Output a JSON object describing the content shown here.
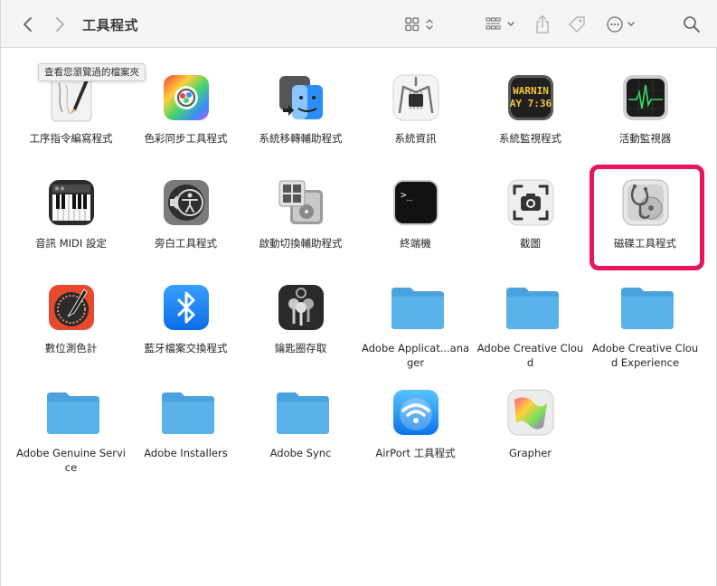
{
  "window": {
    "title": "工具程式",
    "tooltip": "查看您瀏覽過的檔案夾"
  },
  "toolbar": {
    "back_icon": "chevron-left-icon",
    "forward_icon": "chevron-right-icon",
    "view_icon": "grid-view-icon",
    "group_icon": "group-by-icon",
    "share_icon": "share-icon",
    "tag_icon": "tag-icon",
    "action_icon": "ellipsis-circle-icon",
    "search_icon": "search-icon"
  },
  "items": [
    {
      "label": "工序指令編寫程式",
      "icon": "script-editor-icon"
    },
    {
      "label": "色彩同步工具程式",
      "icon": "colorsync-icon"
    },
    {
      "label": "系統移轉輔助程式",
      "icon": "migration-assistant-icon"
    },
    {
      "label": "系統資訊",
      "icon": "system-information-icon"
    },
    {
      "label": "系統監視程式",
      "icon": "console-icon",
      "screen_text_1": "WARNIN",
      "screen_text_2": "AY 7:36"
    },
    {
      "label": "活動監視器",
      "icon": "activity-monitor-icon"
    },
    {
      "label": "音訊 MIDI 設定",
      "icon": "audio-midi-icon"
    },
    {
      "label": "旁白工具程式",
      "icon": "voiceover-icon"
    },
    {
      "label": "啟動切換輔助程式",
      "icon": "boot-camp-icon"
    },
    {
      "label": "終端機",
      "icon": "terminal-icon",
      "screen_text": ">_"
    },
    {
      "label": "截圖",
      "icon": "screenshot-icon"
    },
    {
      "label": "磁碟工具程式",
      "icon": "disk-utility-icon"
    },
    {
      "label": "數位測色計",
      "icon": "digital-color-meter-icon"
    },
    {
      "label": "藍牙檔案交換程式",
      "icon": "bluetooth-icon"
    },
    {
      "label": "鑰匙圈存取",
      "icon": "keychain-icon"
    },
    {
      "label": "Adobe Applicat...anager",
      "icon": "folder-icon"
    },
    {
      "label": "Adobe Creative Cloud",
      "icon": "folder-icon"
    },
    {
      "label": "Adobe Creative Cloud Experience",
      "icon": "folder-icon"
    },
    {
      "label": "Adobe Genuine Service",
      "icon": "folder-icon"
    },
    {
      "label": "Adobe Installers",
      "icon": "folder-icon"
    },
    {
      "label": "Adobe Sync",
      "icon": "folder-icon"
    },
    {
      "label": "AirPort 工具程式",
      "icon": "airport-icon"
    },
    {
      "label": "Grapher",
      "icon": "grapher-icon"
    }
  ],
  "highlighted_item": "磁碟工具程式",
  "colors": {
    "highlight": "#e8175d",
    "folder": "#5ab2ea",
    "folder_tab": "#4aa3df"
  }
}
